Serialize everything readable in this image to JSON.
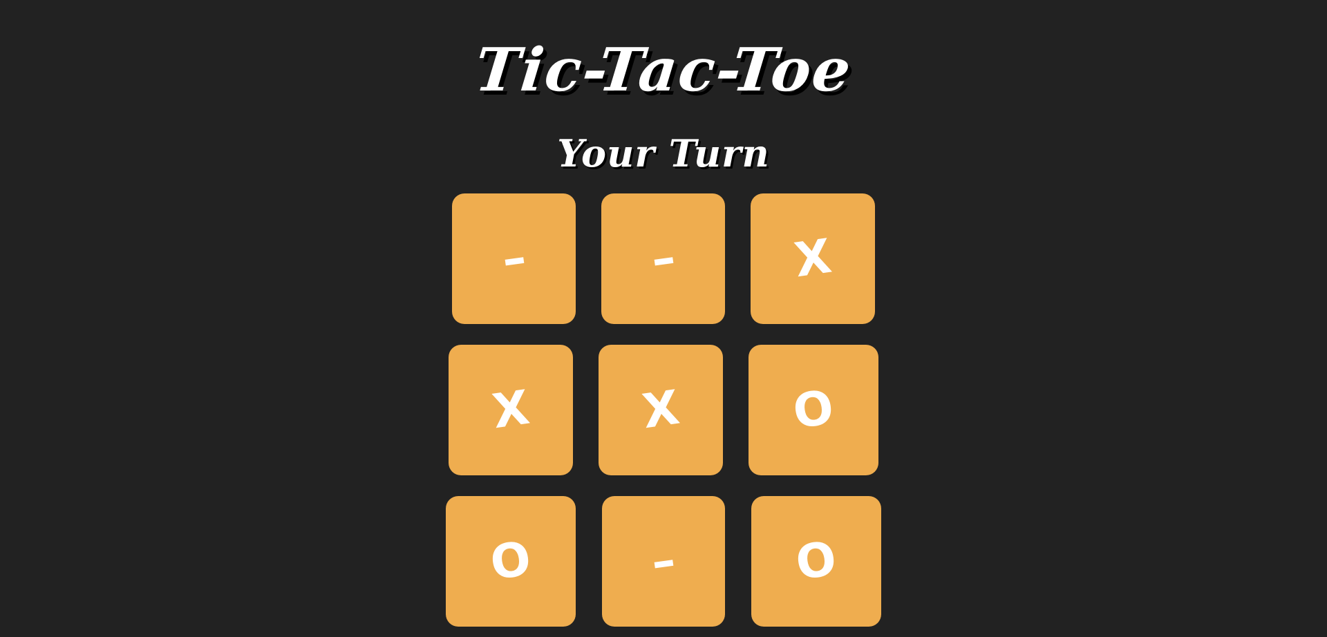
{
  "title": "Tic-Tac-Toe",
  "status": "Your Turn",
  "board": {
    "cells": [
      "–",
      "–",
      "X",
      "X",
      "X",
      "O",
      "O",
      "–",
      "O"
    ]
  },
  "colors": {
    "background": "#222222",
    "cell": "#efad4f",
    "text": "#ffffff"
  }
}
